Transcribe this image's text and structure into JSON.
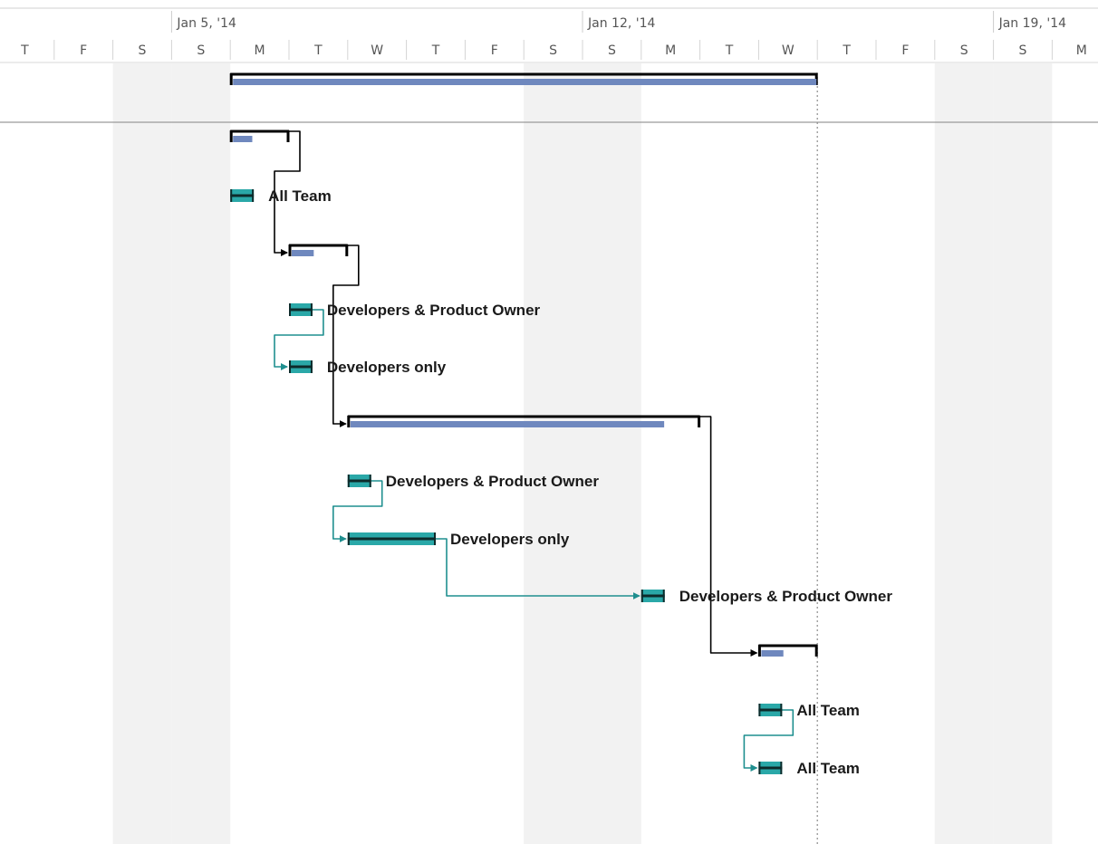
{
  "timescale": {
    "weeks": [
      {
        "label": "Jan 5, '14",
        "start_day_index": 3
      },
      {
        "label": "Jan 12, '14",
        "start_day_index": 10
      },
      {
        "label": "Jan 19, '14",
        "start_day_index": 17
      }
    ],
    "days": [
      "T",
      "F",
      "S",
      "S",
      "M",
      "T",
      "W",
      "T",
      "F",
      "S",
      "S",
      "M",
      "T",
      "W",
      "T",
      "F",
      "S",
      "S",
      "M"
    ],
    "nonworking_day_indices": [
      2,
      3,
      9,
      10,
      16,
      17
    ]
  },
  "status_marker_day_index": 14,
  "colors": {
    "grid_shade": "#f2f2f2",
    "summary_outline": "#000000",
    "progress_bar": "#6f88be",
    "task_bar": "#2aa8a8",
    "summary_link": "#000000",
    "task_link": "#1f8f8f",
    "header_rule": "#9a9a9a",
    "status_line": "#8c8c8c"
  },
  "rows": [
    {
      "type": "summary",
      "start": 4,
      "end": 14,
      "progress": 1.0,
      "label": ""
    },
    {
      "type": "summary",
      "start": 4,
      "end": 5,
      "progress": 0.35,
      "label": ""
    },
    {
      "type": "task",
      "start": 4,
      "end": 4.4,
      "label": "All Team"
    },
    {
      "type": "summary",
      "start": 5,
      "end": 6,
      "progress": 0.4,
      "label": ""
    },
    {
      "type": "task",
      "start": 5,
      "end": 5.4,
      "label": "Developers & Product Owner"
    },
    {
      "type": "task",
      "start": 5,
      "end": 5.4,
      "label": "Developers only"
    },
    {
      "type": "summary",
      "start": 6,
      "end": 12,
      "progress": 0.9,
      "label": ""
    },
    {
      "type": "task",
      "start": 6,
      "end": 6.4,
      "label": "Developers & Product Owner"
    },
    {
      "type": "task",
      "start": 6,
      "end": 7.5,
      "label": "Developers only"
    },
    {
      "type": "task",
      "start": 11,
      "end": 11.4,
      "label": "Developers & Product Owner"
    },
    {
      "type": "summary",
      "start": 13,
      "end": 14,
      "progress": 0.4,
      "label": ""
    },
    {
      "type": "task",
      "start": 13,
      "end": 13.4,
      "label": "All Team"
    },
    {
      "type": "task",
      "start": 13,
      "end": 13.4,
      "label": "All Team"
    }
  ],
  "links": [
    {
      "from": 1,
      "to": 3,
      "kind": "summary"
    },
    {
      "from": 3,
      "to": 6,
      "kind": "summary"
    },
    {
      "from": 6,
      "to": 10,
      "kind": "summary"
    },
    {
      "from": 4,
      "to": 5,
      "kind": "task"
    },
    {
      "from": 7,
      "to": 8,
      "kind": "task"
    },
    {
      "from": 8,
      "to": 9,
      "kind": "task"
    },
    {
      "from": 11,
      "to": 12,
      "kind": "task"
    }
  ]
}
